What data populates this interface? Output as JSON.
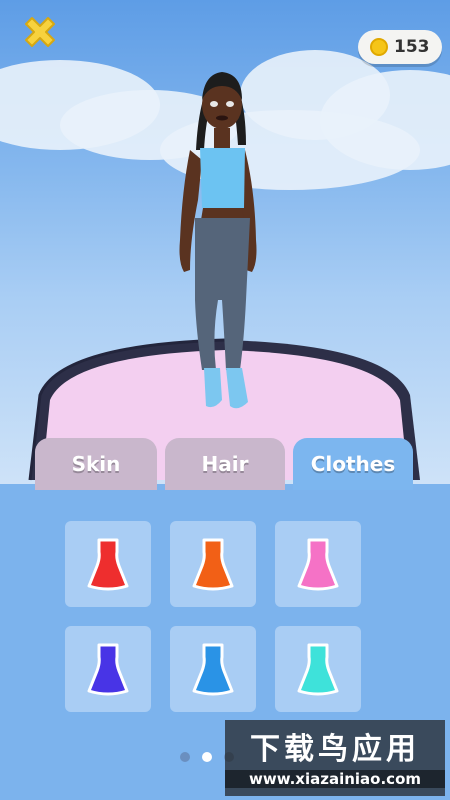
{
  "header": {
    "coins": "153",
    "close_icon": "close-x-icon"
  },
  "tabs": [
    {
      "label": "Skin",
      "active": false
    },
    {
      "label": "Hair",
      "active": false
    },
    {
      "label": "Clothes",
      "active": true
    }
  ],
  "clothes_items": [
    {
      "name": "red-dress",
      "color": "#ee2e2e"
    },
    {
      "name": "orange-dress",
      "color": "#f26016"
    },
    {
      "name": "pink-dress",
      "color": "#f572c6"
    },
    {
      "name": "purple-dress",
      "color": "#4834e6"
    },
    {
      "name": "blue-dress",
      "color": "#2a93e6"
    },
    {
      "name": "cyan-dress",
      "color": "#3ee2da"
    }
  ],
  "pagination": {
    "pages": 3,
    "current": 2
  },
  "watermark": {
    "title": "下载鸟应用",
    "url": "www.xiazainiao.com"
  },
  "colors": {
    "tab_active": "#7cb6ef",
    "tab_inactive": "#c9b7cc",
    "panel": "#7cb3ed",
    "slot": "#a9cdf4",
    "close": "#f7d23e"
  }
}
